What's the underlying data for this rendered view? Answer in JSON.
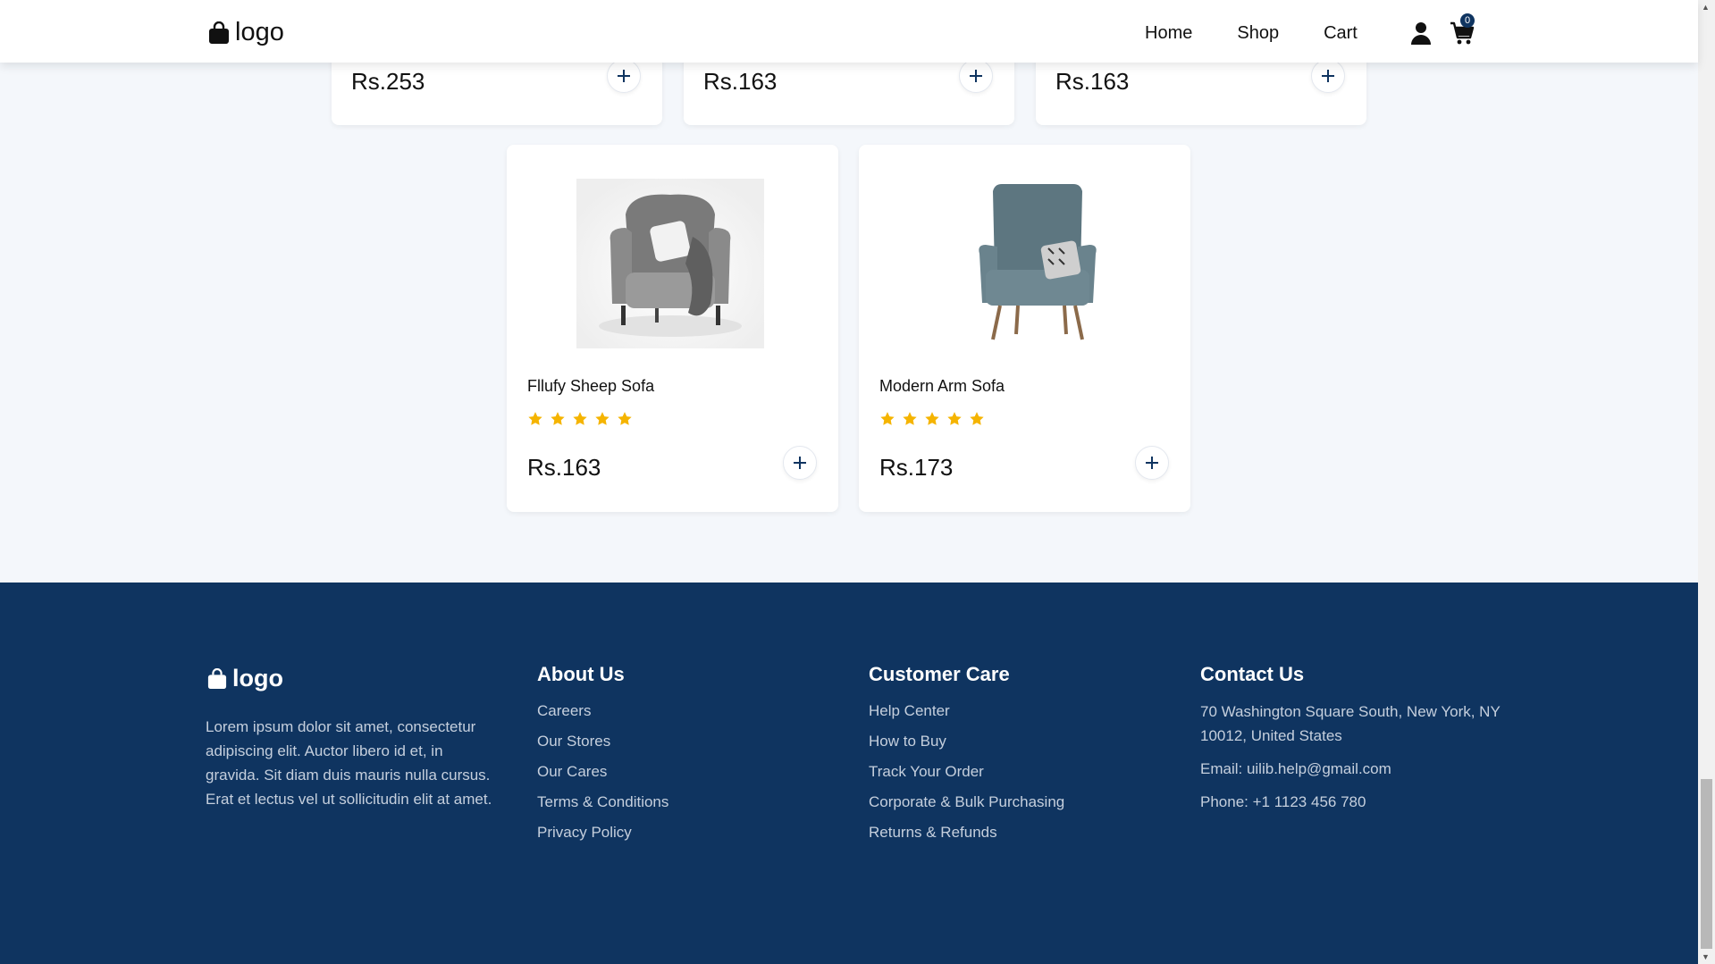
{
  "header": {
    "logo_text": "logo",
    "nav": [
      "Home",
      "Shop",
      "Cart"
    ],
    "cart_count": "0"
  },
  "top_cards": [
    {
      "price": "Rs.253"
    },
    {
      "price": "Rs.163"
    },
    {
      "price": "Rs.163"
    }
  ],
  "products": [
    {
      "name": "Fllufy Sheep Sofa",
      "rating": 5,
      "price": "Rs.163",
      "image": "grey-wingback-armchair-with-fur-throw"
    },
    {
      "name": "Modern Arm Sofa",
      "rating": 5,
      "price": "Rs.173",
      "image": "blue-grey-armchair-with-pillow"
    }
  ],
  "footer": {
    "logo_text": "logo",
    "description": "Lorem ipsum dolor sit amet, consectetur adipiscing elit. Auctor libero id et, in gravida. Sit diam duis mauris nulla cursus. Erat et lectus vel ut sollicitudin elit at amet.",
    "about": {
      "heading": "About Us",
      "links": [
        "Careers",
        "Our Stores",
        "Our Cares",
        "Terms & Conditions",
        "Privacy Policy"
      ]
    },
    "care": {
      "heading": "Customer Care",
      "links": [
        "Help Center",
        "How to Buy",
        "Track Your Order",
        "Corporate & Bulk Purchasing",
        "Returns & Refunds"
      ]
    },
    "contact": {
      "heading": "Contact Us",
      "address": "70 Washington Square South, New York, NY 10012, United States",
      "email": "Email: uilib.help@gmail.com",
      "phone": "Phone: +1 1123 456 780"
    }
  },
  "colors": {
    "footer_bg": "#0f3460",
    "star": "#f5b400",
    "badge": "#0f3460"
  }
}
